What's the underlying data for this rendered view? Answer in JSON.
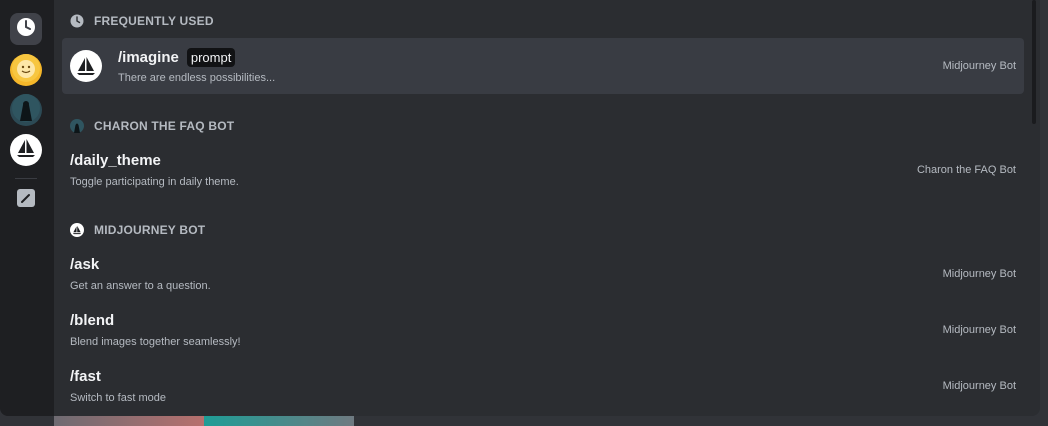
{
  "rail": {
    "items": [
      {
        "icon": "clock-icon"
      },
      {
        "icon": "sun-avatar-icon"
      },
      {
        "icon": "charon-avatar-icon"
      },
      {
        "icon": "midjourney-sailboat-icon"
      },
      {
        "icon": "edit-icon"
      }
    ]
  },
  "sections": [
    {
      "title": "FREQUENTLY USED",
      "icon": "clock-icon",
      "commands": [
        {
          "name": "/imagine",
          "option": "prompt",
          "description": "There are endless possibilities...",
          "source": "Midjourney Bot",
          "selected": true
        }
      ]
    },
    {
      "title": "CHARON THE FAQ BOT",
      "icon": "charon-avatar-icon",
      "commands": [
        {
          "name": "/daily_theme",
          "description": "Toggle participating in daily theme.",
          "source": "Charon the FAQ Bot"
        }
      ]
    },
    {
      "title": "MIDJOURNEY BOT",
      "icon": "midjourney-sailboat-icon",
      "commands": [
        {
          "name": "/ask",
          "description": "Get an answer to a question.",
          "source": "Midjourney Bot"
        },
        {
          "name": "/blend",
          "description": "Blend images together seamlessly!",
          "source": "Midjourney Bot"
        },
        {
          "name": "/fast",
          "description": "Switch to fast mode",
          "source": "Midjourney Bot"
        }
      ]
    }
  ],
  "colors": {
    "panel_bg": "#2b2d31",
    "rail_bg": "#1e1f22",
    "selected_bg": "#393c43",
    "text_primary": "#f2f3f5",
    "text_muted": "#b5bac1"
  }
}
